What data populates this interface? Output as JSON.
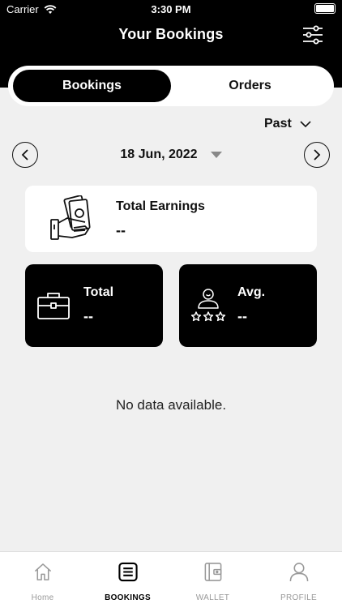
{
  "status_bar": {
    "carrier": "Carrier",
    "time": "3:30 PM"
  },
  "header": {
    "title": "Your Bookings"
  },
  "segments": {
    "active": "Bookings",
    "inactive": "Orders"
  },
  "filter": {
    "period": "Past"
  },
  "date_nav": {
    "date": "18 Jun, 2022"
  },
  "earnings": {
    "title": "Total Earnings",
    "value": "--"
  },
  "stats": {
    "total": {
      "title": "Total",
      "value": "--"
    },
    "avg": {
      "title": "Avg.",
      "value": "--"
    }
  },
  "empty_message": "No data available.",
  "tabbar": {
    "home": "Home",
    "bookings": "BOOKINGS",
    "wallet": "WALLET",
    "profile": "PROFILE"
  }
}
